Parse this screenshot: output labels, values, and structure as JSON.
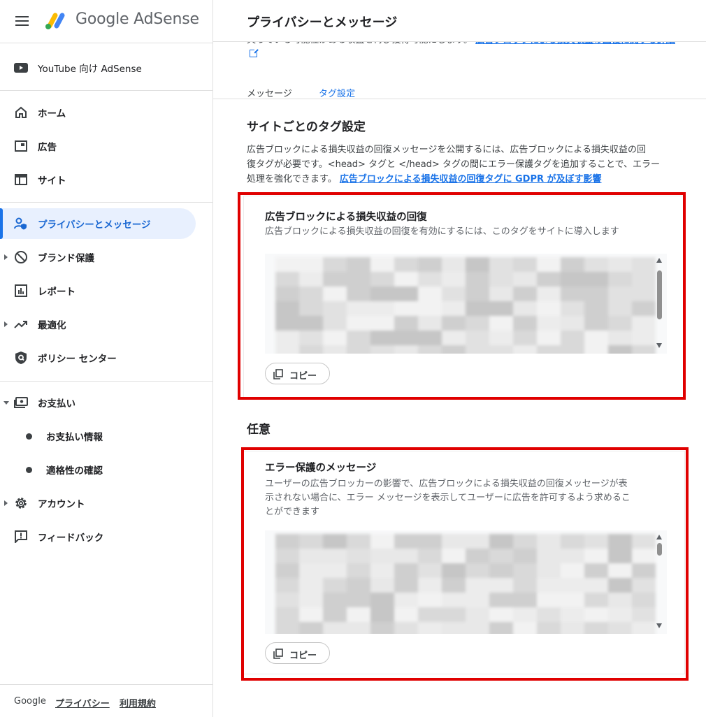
{
  "brand": {
    "name": "Google AdSense"
  },
  "sidebar": {
    "youtube_label": "YouTube 向け AdSense",
    "items": [
      {
        "label": "ホーム"
      },
      {
        "label": "広告"
      },
      {
        "label": "サイト"
      },
      {
        "label": "プライバシーとメッセージ"
      },
      {
        "label": "ブランド保護"
      },
      {
        "label": "レポート"
      },
      {
        "label": "最適化"
      },
      {
        "label": "ポリシー センター"
      },
      {
        "label": "お支払い"
      },
      {
        "label": "お支払い情報"
      },
      {
        "label": "適格性の確認"
      },
      {
        "label": "アカウント"
      },
      {
        "label": "フィードバック"
      }
    ],
    "footer": {
      "google": "Google",
      "privacy": "プライバシー",
      "terms": "利用規約"
    }
  },
  "header": {
    "title": "プライバシーとメッセージ"
  },
  "intro": {
    "text": "失っている可能性がある収益を再び獲得可能にします。",
    "link": "広告ブロックによる損失収益の回復に関する詳細"
  },
  "tabs": [
    {
      "label": "メッセージ"
    },
    {
      "label": "タグ設定"
    }
  ],
  "section": {
    "title": "サイトごとのタグ設定",
    "desc_line1": "広告ブロックによる損失収益の回復メッセージを公開するには、広告ブロックによる損失収益の回",
    "desc_line2": "復タグが必要です。<head> タグと </head> タグの間にエラー保護タグを追加することで、エラー",
    "desc_line3": "処理を強化できます。",
    "desc_link": "広告ブロックによる損失収益の回復タグに GDPR が及ぼす影響"
  },
  "card1": {
    "title": "広告ブロックによる損失収益の回復",
    "desc": "広告ブロックによる損失収益の回復を有効にするには、このタグをサイトに導入します",
    "copy_label": "コピー"
  },
  "optional": {
    "title": "任意"
  },
  "card2": {
    "title": "エラー保護のメッセージ",
    "desc_line1": "ユーザーの広告ブロッカーの影響で、広告ブロックによる損失収益の回復メッセージが表",
    "desc_line2": "示されない場合に、エラー メッセージを表示してユーザーに広告を許可するよう求めるこ",
    "desc_line3": "とができます",
    "copy_label": "コピー"
  },
  "colors": {
    "accent": "#1a73e8",
    "active_bg": "#e8f0fe",
    "highlight": "#e00000"
  }
}
